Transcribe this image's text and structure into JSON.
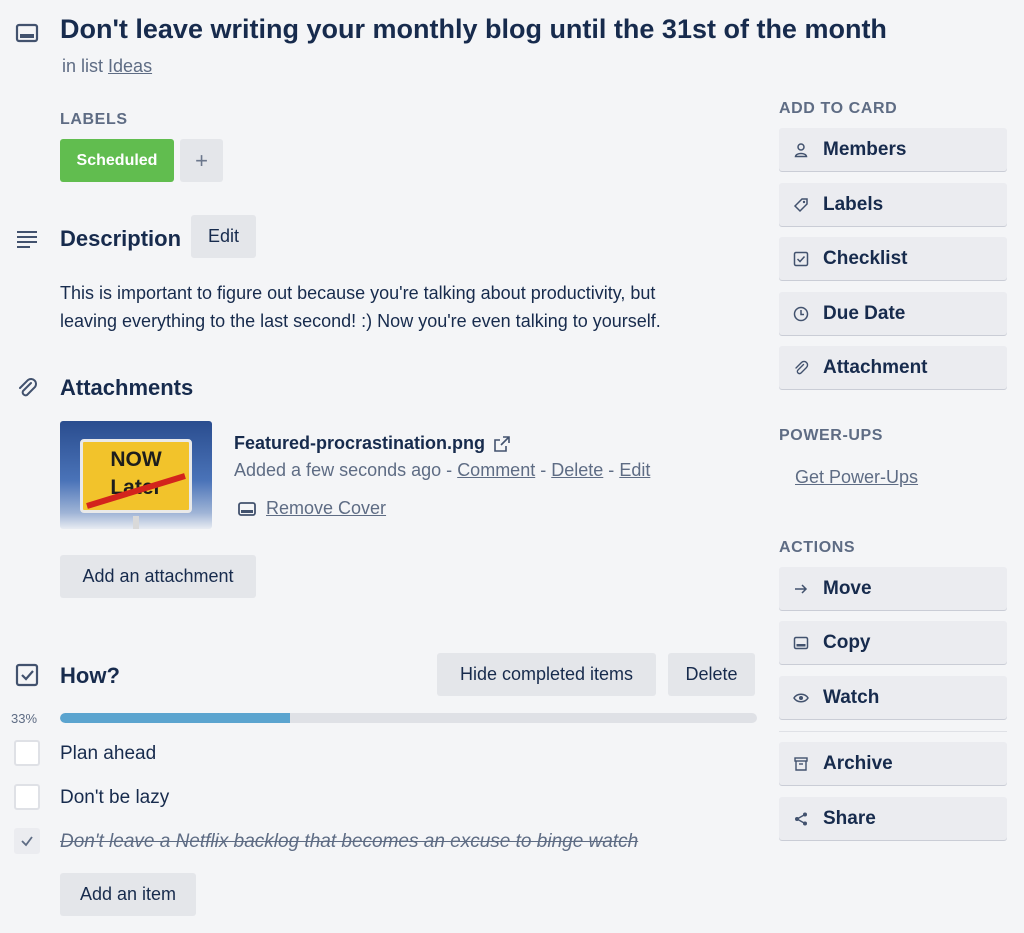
{
  "card": {
    "title": "Don't leave writing your monthly blog until the 31st of the month",
    "in_list_prefix": "in list",
    "list_name": "Ideas"
  },
  "labels": {
    "heading": "LABELS",
    "items": [
      {
        "text": "Scheduled",
        "color": "#61bd4f"
      }
    ],
    "add_symbol": "+"
  },
  "description": {
    "heading": "Description",
    "edit_label": "Edit",
    "line1": "This is important to figure out because you're talking about productivity, but",
    "line2": "leaving everything to the last second! :) Now you're even talking to yourself."
  },
  "attachments": {
    "heading": "Attachments",
    "thumbnail_top": "NOW",
    "thumbnail_bottom": "Later",
    "file_name": "Featured-procrastination.png",
    "added_text": "Added a few seconds ago",
    "sep": "-",
    "comment_label": "Comment",
    "delete_label": "Delete",
    "edit_label": "Edit",
    "remove_cover_label": "Remove Cover",
    "add_label": "Add an attachment"
  },
  "checklist": {
    "heading": "How?",
    "hide_completed_label": "Hide completed items",
    "delete_label": "Delete",
    "progress_text": "33%",
    "progress_fraction": 0.33,
    "items": [
      {
        "text": "Plan ahead",
        "done": false
      },
      {
        "text": "Don't be lazy",
        "done": false
      },
      {
        "text": "Don't leave a Netflix backlog that becomes an excuse to binge watch",
        "done": true
      }
    ],
    "add_item_label": "Add an item"
  },
  "sidebar": {
    "add_to_card_heading": "ADD TO CARD",
    "add_to_card": [
      {
        "label": "Members",
        "icon": "person-icon"
      },
      {
        "label": "Labels",
        "icon": "tag-icon"
      },
      {
        "label": "Checklist",
        "icon": "checkbox-icon"
      },
      {
        "label": "Due Date",
        "icon": "clock-icon"
      },
      {
        "label": "Attachment",
        "icon": "paperclip-icon"
      }
    ],
    "power_ups_heading": "POWER-UPS",
    "get_power_ups_label": "Get Power-Ups",
    "actions_heading": "ACTIONS",
    "actions": [
      {
        "label": "Move",
        "icon": "arrow-right-icon"
      },
      {
        "label": "Copy",
        "icon": "card-icon"
      },
      {
        "label": "Watch",
        "icon": "eye-icon"
      },
      {
        "label": "Archive",
        "icon": "archive-icon"
      },
      {
        "label": "Share",
        "icon": "share-icon"
      }
    ]
  },
  "colors": {
    "accent_progress": "#5ba4cf",
    "label_green": "#61bd4f",
    "text": "#172b4d",
    "muted": "#5e6c84"
  }
}
